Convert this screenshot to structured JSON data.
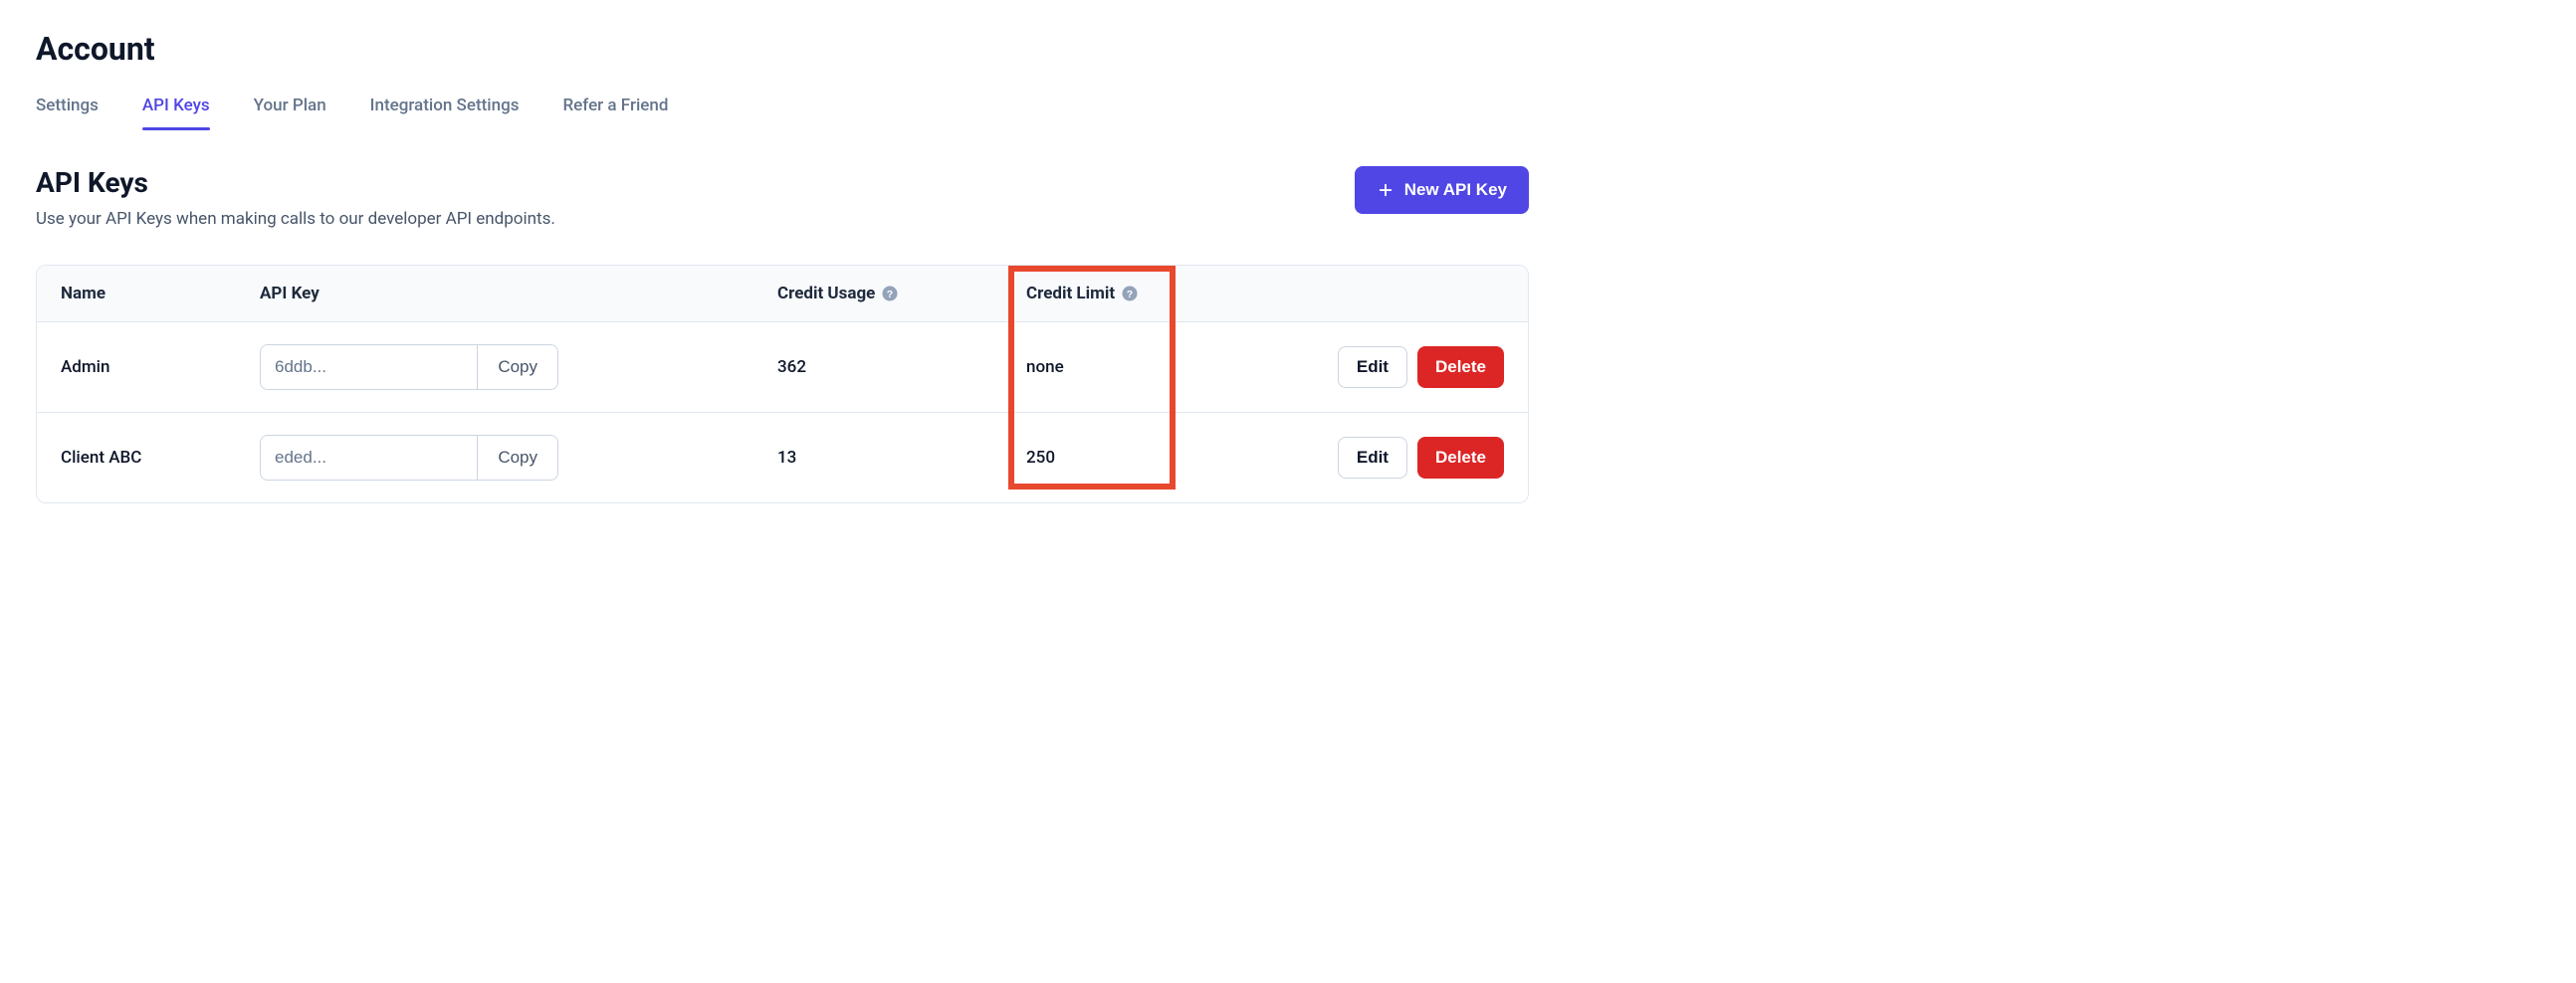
{
  "page_title": "Account",
  "tabs": [
    {
      "label": "Settings",
      "active": false
    },
    {
      "label": "API Keys",
      "active": true
    },
    {
      "label": "Your Plan",
      "active": false
    },
    {
      "label": "Integration Settings",
      "active": false
    },
    {
      "label": "Refer a Friend",
      "active": false
    }
  ],
  "section": {
    "title": "API Keys",
    "desc": "Use your API Keys when making calls to our developer API endpoints."
  },
  "new_key_label": "New API Key",
  "table": {
    "headers": {
      "name": "Name",
      "key": "API Key",
      "usage": "Credit Usage",
      "limit": "Credit Limit"
    },
    "copy_label": "Copy",
    "edit_label": "Edit",
    "delete_label": "Delete",
    "rows": [
      {
        "name": "Admin",
        "key_preview": "6ddb...",
        "usage": "362",
        "limit": "none"
      },
      {
        "name": "Client ABC",
        "key_preview": "eded...",
        "usage": "13",
        "limit": "250"
      }
    ]
  }
}
